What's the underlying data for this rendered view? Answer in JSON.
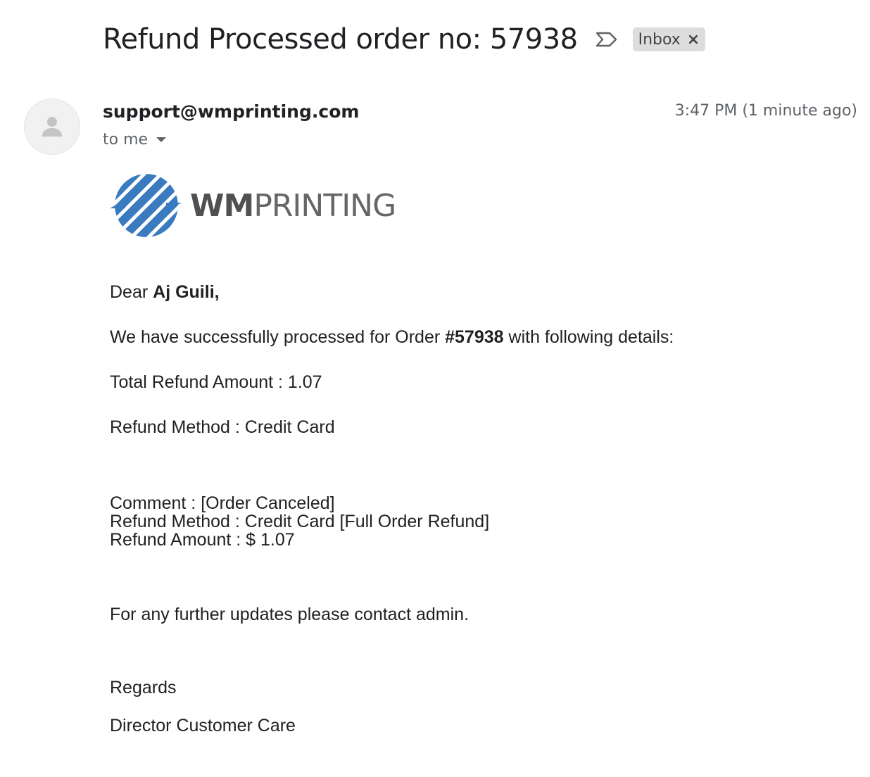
{
  "header": {
    "subject": "Refund Processed order no: 57938",
    "label": "Inbox",
    "label_close": "×",
    "importance_icon": "importance-marker-icon"
  },
  "message": {
    "sender": "support@wmprinting.com",
    "recipient": "to me",
    "timestamp": "3:47 PM (1 minute ago)",
    "avatar_icon": "person-icon"
  },
  "logo": {
    "bold": "WM",
    "light": "PRINTING",
    "brand_color": "#3a7bbf"
  },
  "body": {
    "greeting_prefix": "Dear ",
    "customer_name": "Aj Guili,",
    "intro_prefix": "We have successfully processed for Order ",
    "order_ref": "#57938",
    "intro_suffix": " with following details:",
    "total_refund": "Total Refund Amount :  1.07",
    "refund_method": "Refund Method :  Credit Card",
    "comment_lines": [
      "Comment : [Order Canceled]",
      "Refund Method : Credit Card [Full Order Refund]",
      "Refund Amount : $ 1.07"
    ],
    "contact": "For any further updates please contact admin.",
    "regards": "Regards",
    "signature": "Director Customer Care"
  }
}
